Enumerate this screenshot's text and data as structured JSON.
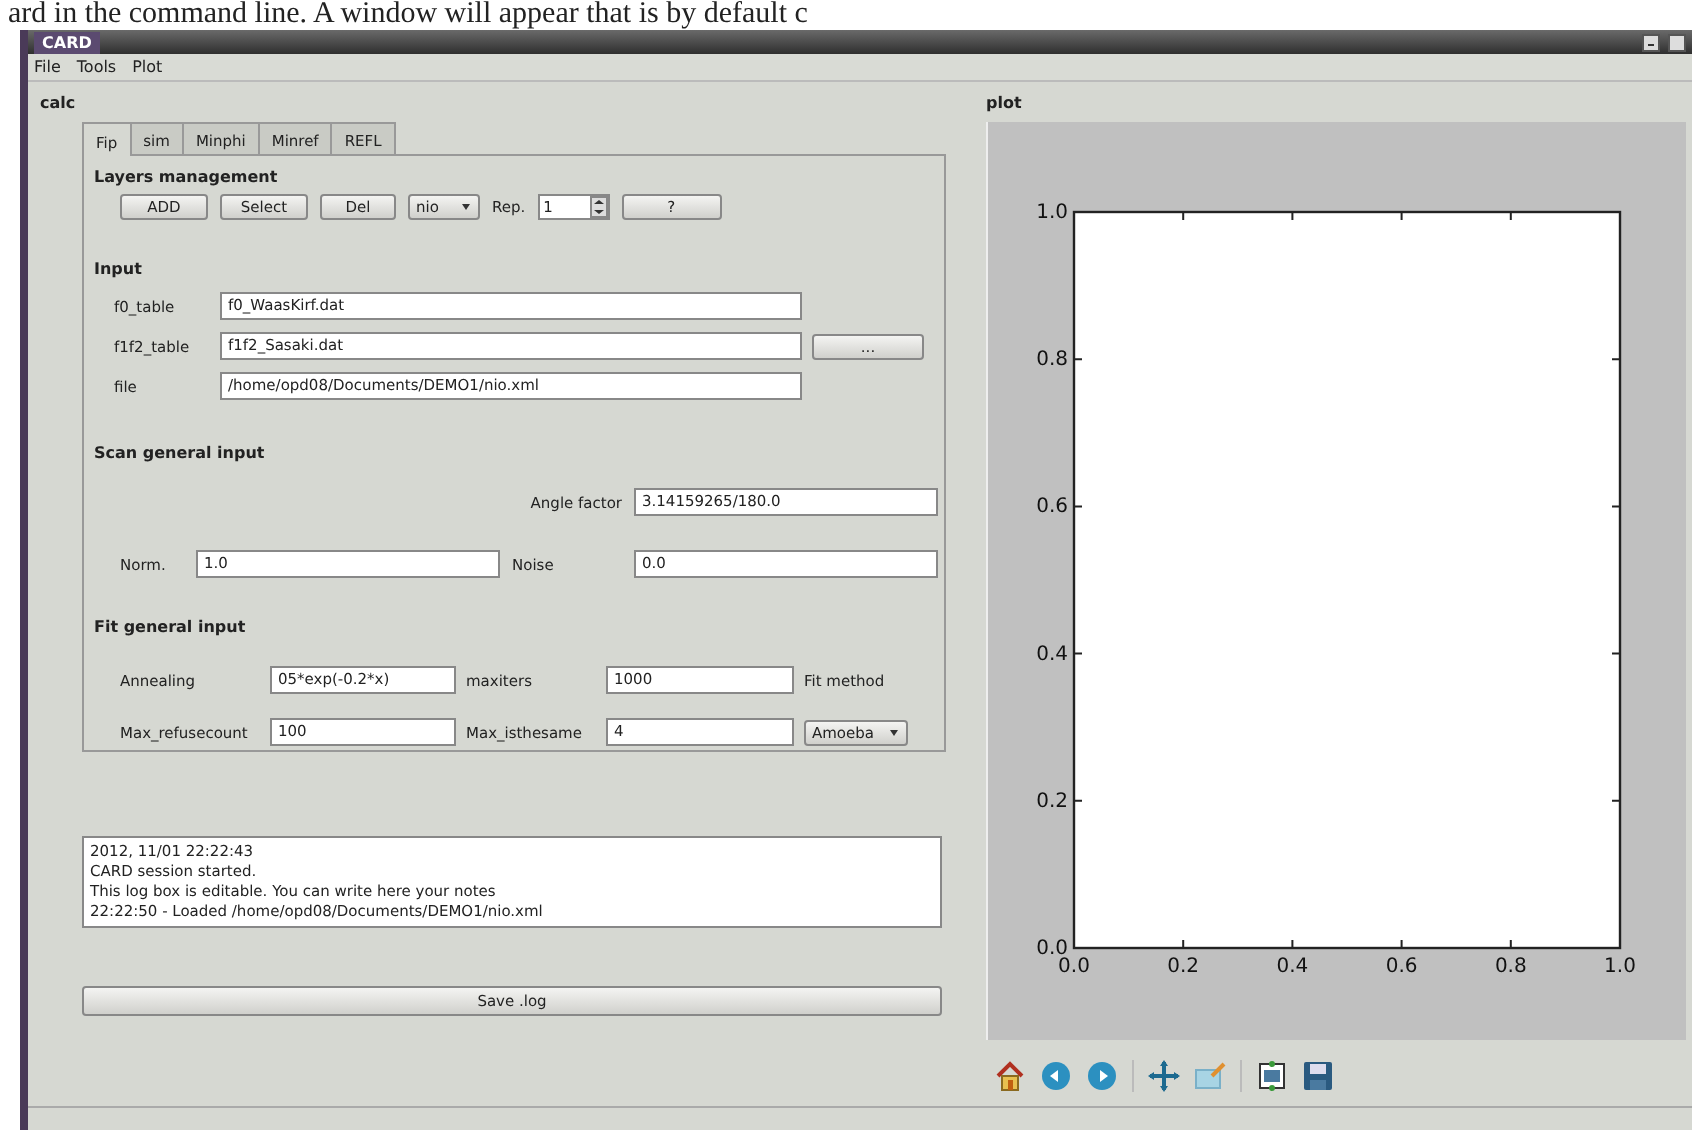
{
  "caption": "ard in the command line. A window will appear that is by default c",
  "window": {
    "title": "CARD"
  },
  "menu": [
    "File",
    "Tools",
    "Plot"
  ],
  "calc": {
    "label": "calc",
    "tabs": [
      {
        "label": "Fip",
        "selected": true
      },
      {
        "label": "sim",
        "selected": false
      },
      {
        "label": "Minphi",
        "selected": false
      },
      {
        "label": "Minref",
        "selected": false
      },
      {
        "label": "REFL",
        "selected": false
      }
    ],
    "layers": {
      "heading": "Layers management",
      "buttons": [
        "ADD",
        "Select",
        "Del"
      ],
      "combo": "nio",
      "rep_label": "Rep.",
      "rep_value": "1",
      "help": "?"
    },
    "input": {
      "heading": "Input",
      "rows": [
        {
          "label": "f0_table",
          "value": "f0_WaasKirf.dat"
        },
        {
          "label": "f1f2_table",
          "value": "f1f2_Sasaki.dat",
          "button": "..."
        },
        {
          "label": "file",
          "value": "/home/opd08/Documents/DEMO1/nio.xml"
        }
      ]
    },
    "scan": {
      "heading": "Scan general input",
      "angle": {
        "label": "Angle factor",
        "value": "3.14159265/180.0"
      },
      "norm": {
        "label": "Norm.",
        "value": "1.0"
      },
      "noise": {
        "label": "Noise",
        "value": "0.0"
      }
    },
    "fit": {
      "heading": "Fit general input",
      "rows": [
        [
          {
            "label": "Annealing",
            "value": "05*exp(-0.2*x)"
          },
          {
            "label": "maxiters",
            "value": "1000"
          }
        ],
        [
          {
            "label": "Max_refusecount",
            "value": "100"
          },
          {
            "label": "Max_isthesame",
            "value": "4"
          }
        ]
      ],
      "method_label": "Fit method",
      "method": "Amoeba"
    },
    "log": [
      "2012, 11/01 22:22:43",
      "CARD session started.",
      "This log box is editable. You can write here your notes",
      "22:22:50 - Loaded /home/opd08/Documents/DEMO1/nio.xml"
    ],
    "save_button": "Save .log"
  },
  "plot": {
    "label": "plot",
    "chart_data": {
      "type": "line",
      "xlim": [
        0,
        1
      ],
      "ylim": [
        0,
        1
      ],
      "xticks": [
        {
          "value": 0,
          "label": "0.0"
        },
        {
          "value": 0.2,
          "label": "0.2"
        },
        {
          "value": 0.4,
          "label": "0.4"
        },
        {
          "value": 0.6,
          "label": "0.6"
        },
        {
          "value": 0.8,
          "label": "0.8"
        },
        {
          "value": 1,
          "label": "1.0"
        }
      ],
      "yticks": [
        {
          "value": 0,
          "label": "0.0"
        },
        {
          "value": 0.2,
          "label": "0.2"
        },
        {
          "value": 0.4,
          "label": "0.4"
        },
        {
          "value": 0.6,
          "label": "0.6"
        },
        {
          "value": 0.8,
          "label": "0.8"
        },
        {
          "value": 1,
          "label": "1.0"
        }
      ]
    },
    "toolbar": [
      {
        "kind": "home"
      },
      {
        "kind": "back"
      },
      {
        "kind": "forward"
      },
      {
        "kind": "separator"
      },
      {
        "kind": "pan"
      },
      {
        "kind": "zoom"
      },
      {
        "kind": "separator"
      },
      {
        "kind": "subplots"
      },
      {
        "kind": "save"
      }
    ]
  }
}
